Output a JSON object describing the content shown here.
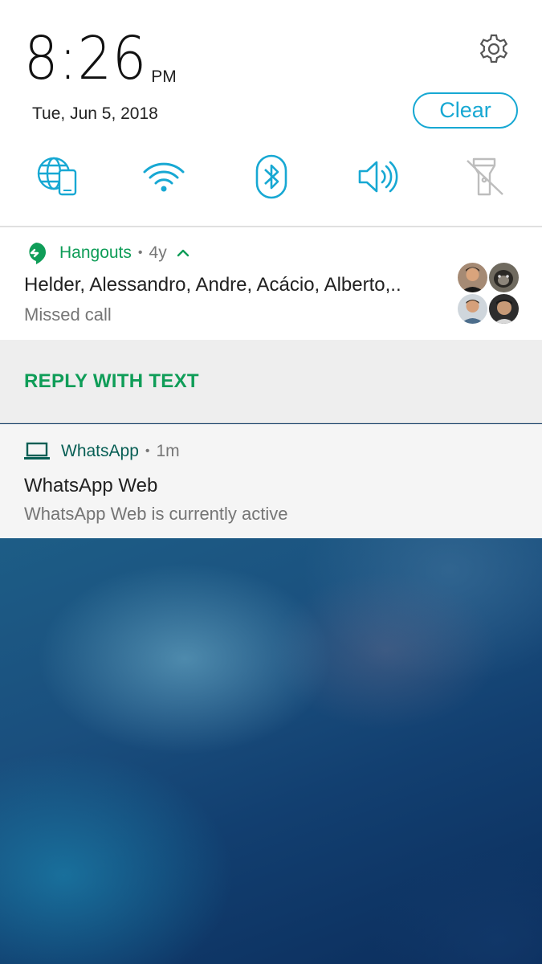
{
  "quick_settings": {
    "time": "8:26",
    "ampm": "PM",
    "date": "Tue, Jun 5, 2018",
    "clear_label": "Clear",
    "tiles": [
      {
        "icon": "data-roaming-icon",
        "state": "on"
      },
      {
        "icon": "wifi-icon",
        "state": "on"
      },
      {
        "icon": "bluetooth-icon",
        "state": "on"
      },
      {
        "icon": "sound-icon",
        "state": "on"
      },
      {
        "icon": "flashlight-off-icon",
        "state": "off"
      }
    ],
    "accent_color": "#17a8d3"
  },
  "notifications": [
    {
      "app": "Hangouts",
      "age": "4y",
      "app_color": "#0f9d58",
      "title": "Helder, Alessandro, Andre, Acácio, Alberto,..",
      "text": "Missed call",
      "action": "REPLY WITH TEXT"
    },
    {
      "app": "WhatsApp",
      "age": "1m",
      "app_color": "#075e54",
      "title": "WhatsApp Web",
      "text": "WhatsApp Web is currently active"
    }
  ]
}
